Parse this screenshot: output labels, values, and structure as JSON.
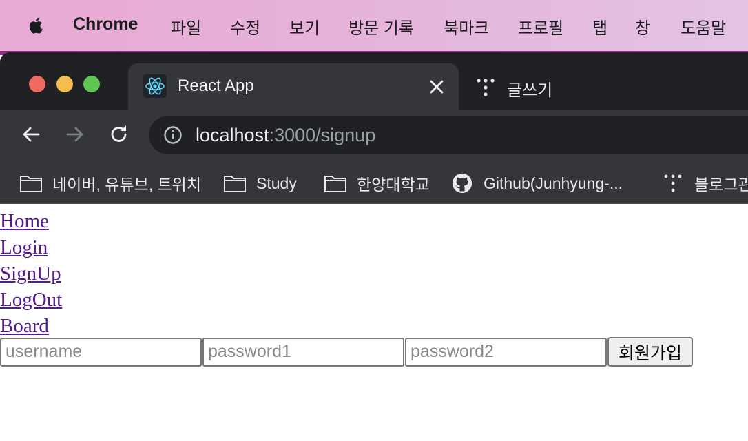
{
  "menubar": {
    "app_name": "Chrome",
    "items": [
      "파일",
      "수정",
      "보기",
      "방문 기록",
      "북마크",
      "프로필",
      "탭",
      "창",
      "도움말"
    ]
  },
  "tabs": [
    {
      "title": "React App",
      "icon": "react-logo-icon",
      "active": true
    },
    {
      "title": "글쓰기",
      "icon": "tistory-icon",
      "active": false
    }
  ],
  "address_bar": {
    "host": "localhost",
    "path": ":3000/signup"
  },
  "bookmarks": [
    {
      "label": "네이버, 유튜브, 트위치",
      "icon": "folder-icon"
    },
    {
      "label": "Study",
      "icon": "folder-icon"
    },
    {
      "label": "한양대학교",
      "icon": "folder-icon"
    },
    {
      "label": "Github(Junhyung-...",
      "icon": "github-icon"
    },
    {
      "label": "블로그관",
      "icon": "tistory-icon"
    }
  ],
  "page": {
    "nav_links": [
      "Home",
      "Login",
      "SignUp",
      "LogOut",
      "Board"
    ],
    "form": {
      "username_placeholder": "username",
      "password1_placeholder": "password1",
      "password2_placeholder": "password2",
      "submit_label": "회원가입"
    }
  },
  "colors": {
    "link_visited": "#551a8b",
    "chrome_dark": "#202124",
    "chrome_toolbar": "#35363a"
  }
}
